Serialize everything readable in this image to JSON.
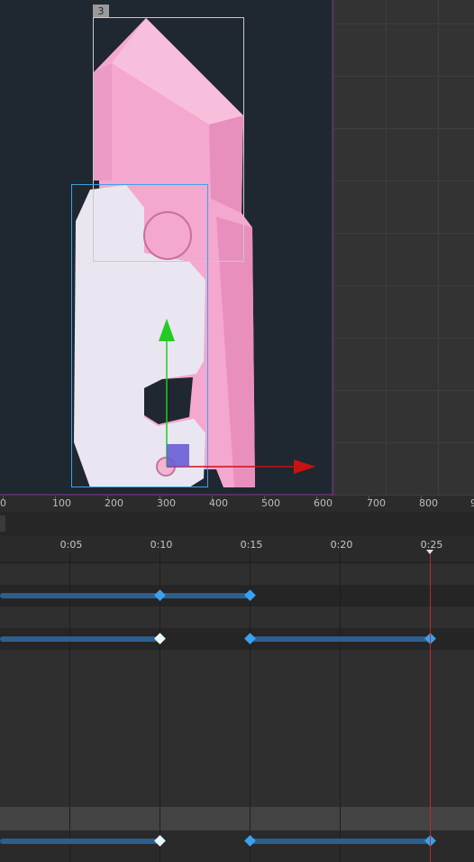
{
  "viewport": {
    "bone_label": "3",
    "colors": {
      "bg_left": "#1f2730",
      "bg_right": "#333333",
      "grid": "#4a4a4a",
      "pink": "#f4a8cf",
      "white_part": "#e9e6f1",
      "bbox1": "#c9c9c9",
      "bbox2": "#3fa2e6"
    },
    "gizmo": {
      "y_axis_color": "#22cc22",
      "x_axis_color": "#cc1111",
      "center_color": "#6a5cd6"
    }
  },
  "ruler": {
    "labels": [
      "0",
      "100",
      "200",
      "300",
      "400",
      "500",
      "600",
      "700",
      "800",
      "9"
    ]
  },
  "timeline": {
    "time_labels": [
      "0:05",
      "0:10",
      "0:15",
      "0:20",
      "0:25"
    ],
    "playhead_label": "0:25",
    "colors": {
      "bar": "#2b5f8f",
      "key_blue": "#3aa0f0",
      "key_white": "#e8f6ff",
      "playhead": "#c0292b"
    }
  }
}
